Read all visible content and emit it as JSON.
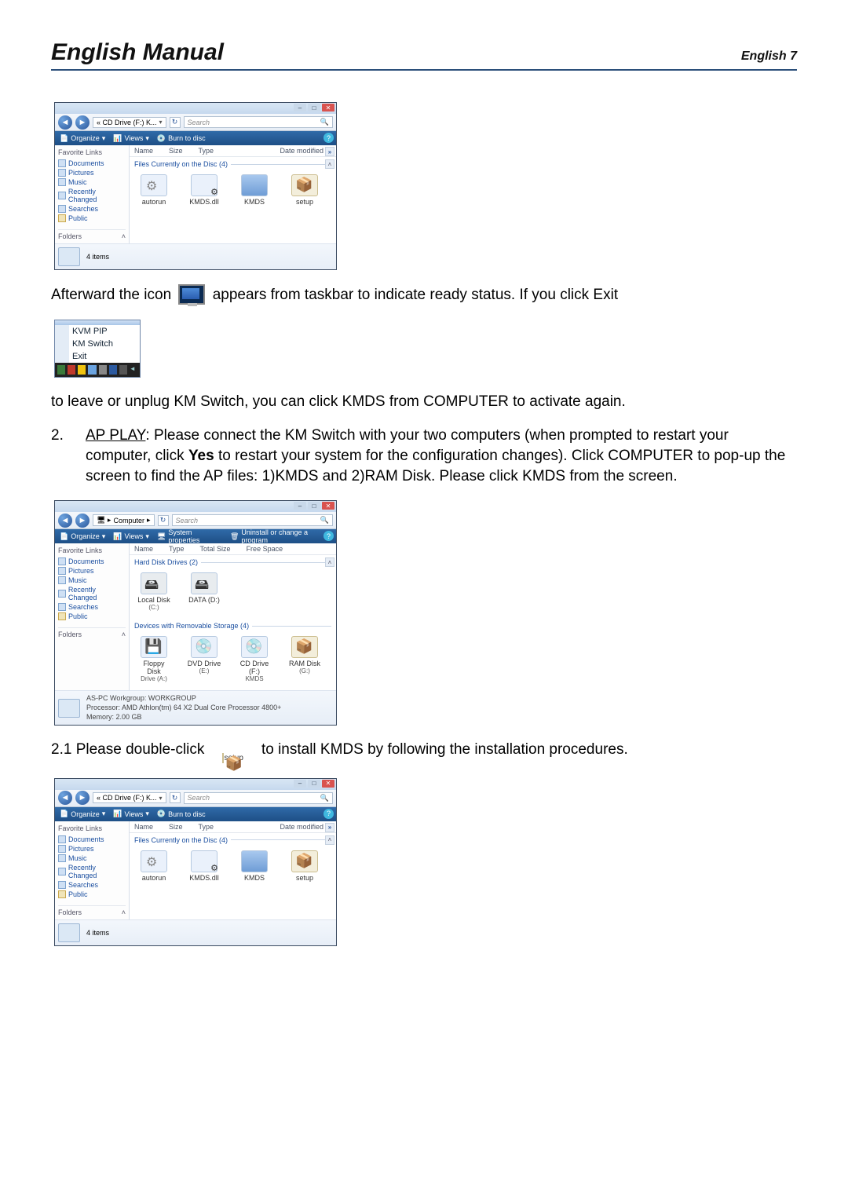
{
  "header": {
    "title": "English Manual",
    "right": "English  7"
  },
  "favLinksTitle": "Favorite Links",
  "favLinks": [
    "Documents",
    "Pictures",
    "Music",
    "Recently Changed",
    "Searches",
    "Public"
  ],
  "foldersLabel": "Folders",
  "explorer1": {
    "crumb": "« CD Drive (F:) K...",
    "search": "Search",
    "toolbar": {
      "organize": "Organize",
      "views": "Views",
      "burn": "Burn to disc"
    },
    "cols": [
      "Name",
      "Size",
      "Type",
      "Date modified"
    ],
    "group": "Files Currently on the Disc (4)",
    "files": [
      {
        "name": "autorun",
        "kind": "cog"
      },
      {
        "name": "KMDS.dll",
        "kind": "gear"
      },
      {
        "name": "KMDS",
        "kind": "app"
      },
      {
        "name": "setup",
        "kind": "box"
      }
    ],
    "status": "4 items"
  },
  "para1a": "Afterward the icon",
  "para1b": "appears from taskbar to indicate ready status.  If you click Exit",
  "ctxmenu": [
    "KVM PIP",
    "KM Switch",
    "Exit"
  ],
  "para2": "to leave or unplug KM Switch, you can click KMDS from COMPUTER to activate again.",
  "para3": {
    "num": "2.",
    "label": "AP PLAY",
    "t1": ":  Please connect the KM Switch with your two computers (when prompted to restart your computer, click ",
    "bold": "Yes",
    "t2": " to restart your system for the configuration changes).  Click COMPUTER to pop-up the screen to find the AP files: 1)KMDS and 2)RAM Disk.   Please click KMDS from the screen."
  },
  "explorer2": {
    "crumb": "Computer",
    "search": "Search",
    "toolbar": {
      "organize": "Organize",
      "views": "Views",
      "sysprops": "System properties",
      "uninstall": "Uninstall or change a program"
    },
    "cols": [
      "Name",
      "Type",
      "Total Size",
      "Free Space"
    ],
    "group1": "Hard Disk Drives (2)",
    "hdd": [
      {
        "name": "Local Disk",
        "sub": "(C:)"
      },
      {
        "name": "DATA (D:)",
        "sub": ""
      }
    ],
    "group2": "Devices with Removable Storage (4)",
    "rem": [
      {
        "name": "Floppy Disk",
        "sub": "Drive (A:)",
        "kind": "floppy"
      },
      {
        "name": "DVD Drive",
        "sub": "(E:)",
        "kind": "dvd"
      },
      {
        "name": "CD Drive (F:)",
        "sub": "KMDS",
        "kind": "dvd"
      },
      {
        "name": "RAM Disk",
        "sub": "(G:)",
        "kind": "box"
      }
    ],
    "sys": {
      "l1": "AS-PC  Workgroup: WORKGROUP",
      "l2": "Processor: AMD Athlon(tm) 64 X2 Dual Core Processor 4800+",
      "l3": "Memory: 2.00 GB"
    }
  },
  "para4a": "2.1 Please double-click",
  "setupLabel": "setup",
  "para4b": "to install KMDS by following the installation procedures."
}
